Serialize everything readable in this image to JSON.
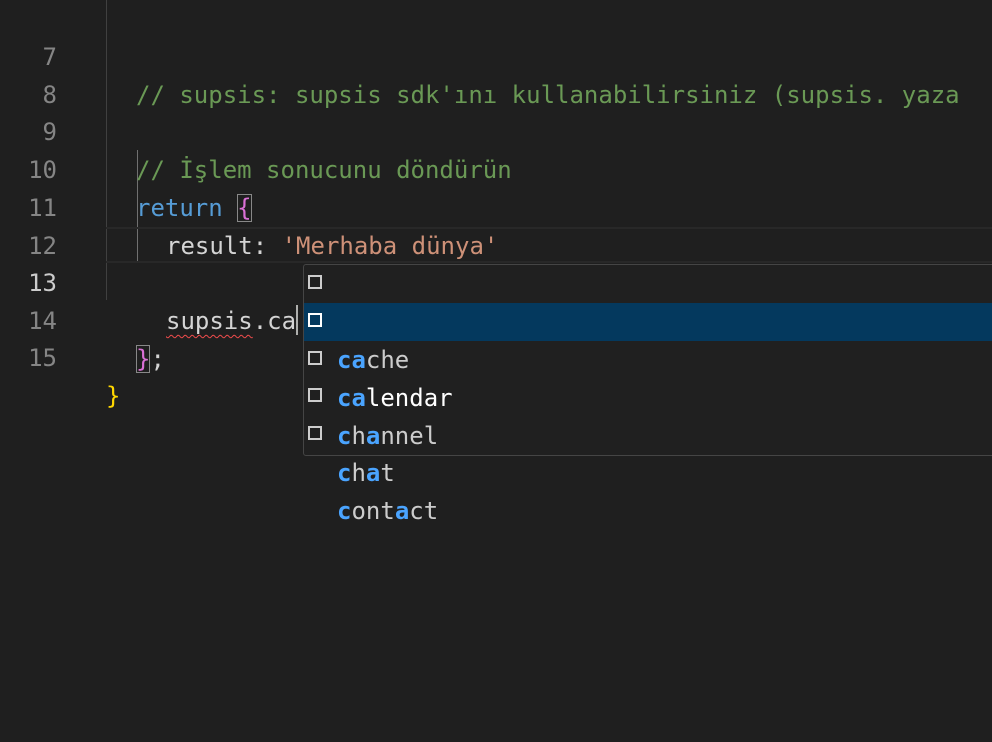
{
  "editor": {
    "lines": [
      {
        "number": "7",
        "text": "// supsis: supsis sdk'ını kullanabilirsiniz (supsis. yaza"
      },
      {
        "number": "8",
        "text": ""
      },
      {
        "number": "9",
        "text": "// İşlem sonucunu döndürün"
      },
      {
        "number": "10",
        "keyword": "return",
        "brace": "{"
      },
      {
        "number": "11",
        "prop": "result:",
        "string": "'Merhaba dünya'"
      },
      {
        "number": "12",
        "text": ""
      },
      {
        "number": "13",
        "squiggled": "supsis",
        "rest": ".ca"
      },
      {
        "number": "14",
        "brace": "}",
        "semi": ";"
      },
      {
        "number": "15",
        "brace": "}"
      }
    ],
    "active_line": "13"
  },
  "suggestions": {
    "items": [
      {
        "pre": "",
        "m1": "ca",
        "mid": "che",
        "m2": "",
        "post": ""
      },
      {
        "pre": "",
        "m1": "ca",
        "mid": "lendar",
        "m2": "",
        "post": ""
      },
      {
        "pre": "",
        "m1": "c",
        "mid": "h",
        "m2": "a",
        "post": "nnel"
      },
      {
        "pre": "",
        "m1": "c",
        "mid": "h",
        "m2": "a",
        "post": "t"
      },
      {
        "pre": "",
        "m1": "c",
        "mid": "ont",
        "m2": "a",
        "post": "ct"
      }
    ],
    "selected_index": 1,
    "icon": "property-box-icon"
  },
  "colors": {
    "background": "#1f1f1f",
    "comment": "#6a9955",
    "keyword": "#569cd6",
    "string": "#ce9178",
    "brace_outer": "#ffd700",
    "brace_inner": "#da70d6",
    "match_highlight": "#4aa4ff",
    "selection": "#04395e"
  }
}
